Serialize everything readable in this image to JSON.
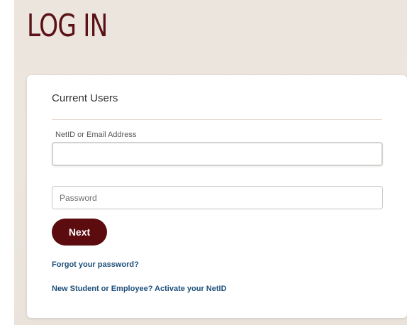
{
  "page": {
    "title": "LOG IN"
  },
  "login_card": {
    "heading": "Current Users",
    "netid": {
      "label": "NetID or Email Address",
      "value": "",
      "placeholder": ""
    },
    "password": {
      "value": "",
      "placeholder": "Password"
    },
    "next_label": "Next",
    "forgot_link": "Forgot your password?",
    "activate_link": "New Student or Employee? Activate your NetID"
  },
  "colors": {
    "brand_maroon": "#5c0b0f",
    "title_color": "#5b1216",
    "link_color": "#1d4f7a",
    "background": "#ece5dd"
  }
}
